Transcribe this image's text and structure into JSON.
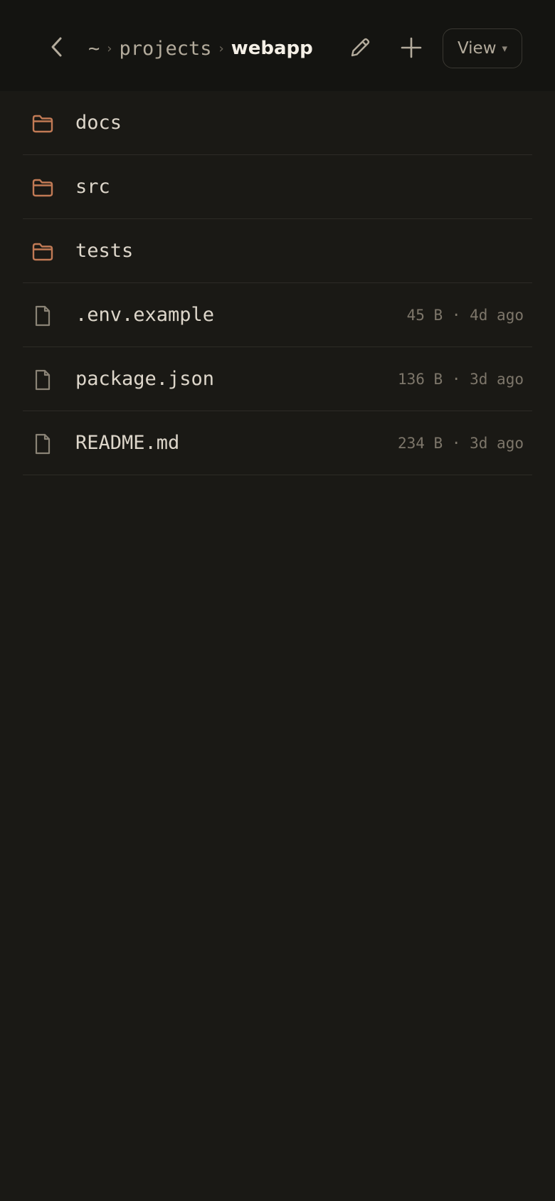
{
  "header": {
    "breadcrumb": [
      {
        "label": "~"
      },
      {
        "label": "projects"
      }
    ],
    "current": "webapp",
    "view_label": "View",
    "view_caret": "▾",
    "separator": "›"
  },
  "colors": {
    "folder_accent": "#c17a55",
    "file_icon": "#8a8376",
    "background": "#1a1915",
    "header_background": "#141411"
  },
  "items": [
    {
      "type": "folder",
      "icon": "folder-icon",
      "name": "docs",
      "meta": ""
    },
    {
      "type": "folder",
      "icon": "folder-icon",
      "name": "src",
      "meta": ""
    },
    {
      "type": "folder",
      "icon": "folder-icon",
      "name": "tests",
      "meta": ""
    },
    {
      "type": "file",
      "icon": "file-icon",
      "name": ".env.example",
      "meta": "45 B · 4d ago"
    },
    {
      "type": "file",
      "icon": "file-icon",
      "name": "package.json",
      "meta": "136 B · 3d ago"
    },
    {
      "type": "file",
      "icon": "file-icon",
      "name": "README.md",
      "meta": "234 B · 3d ago"
    }
  ]
}
